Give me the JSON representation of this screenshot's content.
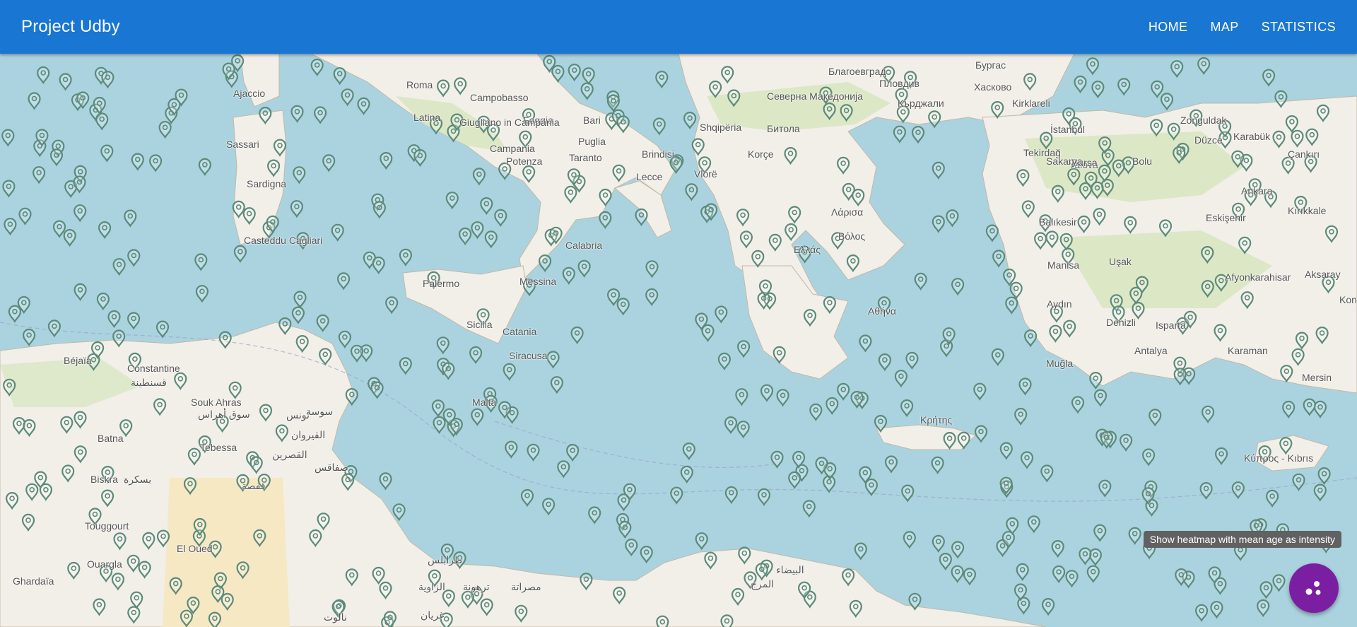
{
  "appbar": {
    "title": "Project Udby",
    "nav": [
      {
        "label": "HOME"
      },
      {
        "label": "MAP"
      },
      {
        "label": "STATISTICS"
      }
    ]
  },
  "map": {
    "marker_icon": "map-marker-icon",
    "labels": [
      {
        "text": "Roma"
      },
      {
        "text": "Latina"
      },
      {
        "text": "Campobasso"
      },
      {
        "text": "Foggia"
      },
      {
        "text": "Bari"
      },
      {
        "text": "Giugliano in Campania"
      },
      {
        "text": "Campania"
      },
      {
        "text": "Potenza"
      },
      {
        "text": "Taranto"
      },
      {
        "text": "Brindisi"
      },
      {
        "text": "Lecce"
      },
      {
        "text": "Puglia"
      },
      {
        "text": "Calabria"
      },
      {
        "text": "Messina"
      },
      {
        "text": "Palermo"
      },
      {
        "text": "Sicilia"
      },
      {
        "text": "Catania"
      },
      {
        "text": "Siracusa"
      },
      {
        "text": "Malta"
      },
      {
        "text": "Ajaccio"
      },
      {
        "text": "Sassari"
      },
      {
        "text": "Sardigna"
      },
      {
        "text": "Casteddu Cagliari"
      },
      {
        "text": "Shqipëria"
      },
      {
        "text": "Korçe"
      },
      {
        "text": "Vlorë"
      },
      {
        "text": "Ελλάς"
      },
      {
        "text": "Λάρισα"
      },
      {
        "text": "Βόλος"
      },
      {
        "text": "Αθήνα"
      },
      {
        "text": "Битола"
      },
      {
        "text": "Северна Македонија"
      },
      {
        "text": "Благоевград"
      },
      {
        "text": "Пловдив"
      },
      {
        "text": "Хасково"
      },
      {
        "text": "Кърджали"
      },
      {
        "text": "Бургас"
      },
      {
        "text": "Kirklareli"
      },
      {
        "text": "Tekirdağ"
      },
      {
        "text": "İstanbul"
      },
      {
        "text": "Yalova"
      },
      {
        "text": "Bursa"
      },
      {
        "text": "Balıkesir"
      },
      {
        "text": "Sakarya"
      },
      {
        "text": "Bolu"
      },
      {
        "text": "Düzce"
      },
      {
        "text": "Zonguldak"
      },
      {
        "text": "Karabük"
      },
      {
        "text": "Çankırı"
      },
      {
        "text": "Ankara"
      },
      {
        "text": "Kırıkkale"
      },
      {
        "text": "Aksaray"
      },
      {
        "text": "Konya"
      },
      {
        "text": "Uşak"
      },
      {
        "text": "Aydın"
      },
      {
        "text": "Isparta"
      },
      {
        "text": "Antalya"
      },
      {
        "text": "Karaman"
      },
      {
        "text": "Mersin"
      },
      {
        "text": "Κύπρος - Kıbrıs"
      },
      {
        "text": "Muğla"
      },
      {
        "text": "Denizli"
      },
      {
        "text": "Eskişehir"
      },
      {
        "text": "Afyonkarahisar"
      },
      {
        "text": "Manisa"
      },
      {
        "text": "Constantine"
      },
      {
        "text": "قسنطينة"
      },
      {
        "text": "Béjaïa"
      },
      {
        "text": "Souk Ahras"
      },
      {
        "text": "سوق أهراس"
      },
      {
        "text": "تونس"
      },
      {
        "text": "Tebessa"
      },
      {
        "text": "Batna"
      },
      {
        "text": "Biskra"
      },
      {
        "text": "بسكرة"
      },
      {
        "text": "Touggourt"
      },
      {
        "text": "Ouargla"
      },
      {
        "text": "Ghardaïa"
      },
      {
        "text": "El Oued"
      },
      {
        "text": "صفاقس"
      },
      {
        "text": "سوسة"
      },
      {
        "text": "القيروان"
      },
      {
        "text": "القصرين"
      },
      {
        "text": "قفصة"
      },
      {
        "text": "الزاوية"
      },
      {
        "text": "طرابلس"
      },
      {
        "text": "مصراتة"
      },
      {
        "text": "ترهونة"
      },
      {
        "text": "نالوت"
      },
      {
        "text": "غريان"
      },
      {
        "text": "البيضاء"
      },
      {
        "text": "المرج"
      },
      {
        "text": "Κρήτης"
      }
    ]
  },
  "tooltip": {
    "text": "Show heatmap with mean age as intensity"
  },
  "fab": {
    "icon": "scatter-dots-icon"
  }
}
